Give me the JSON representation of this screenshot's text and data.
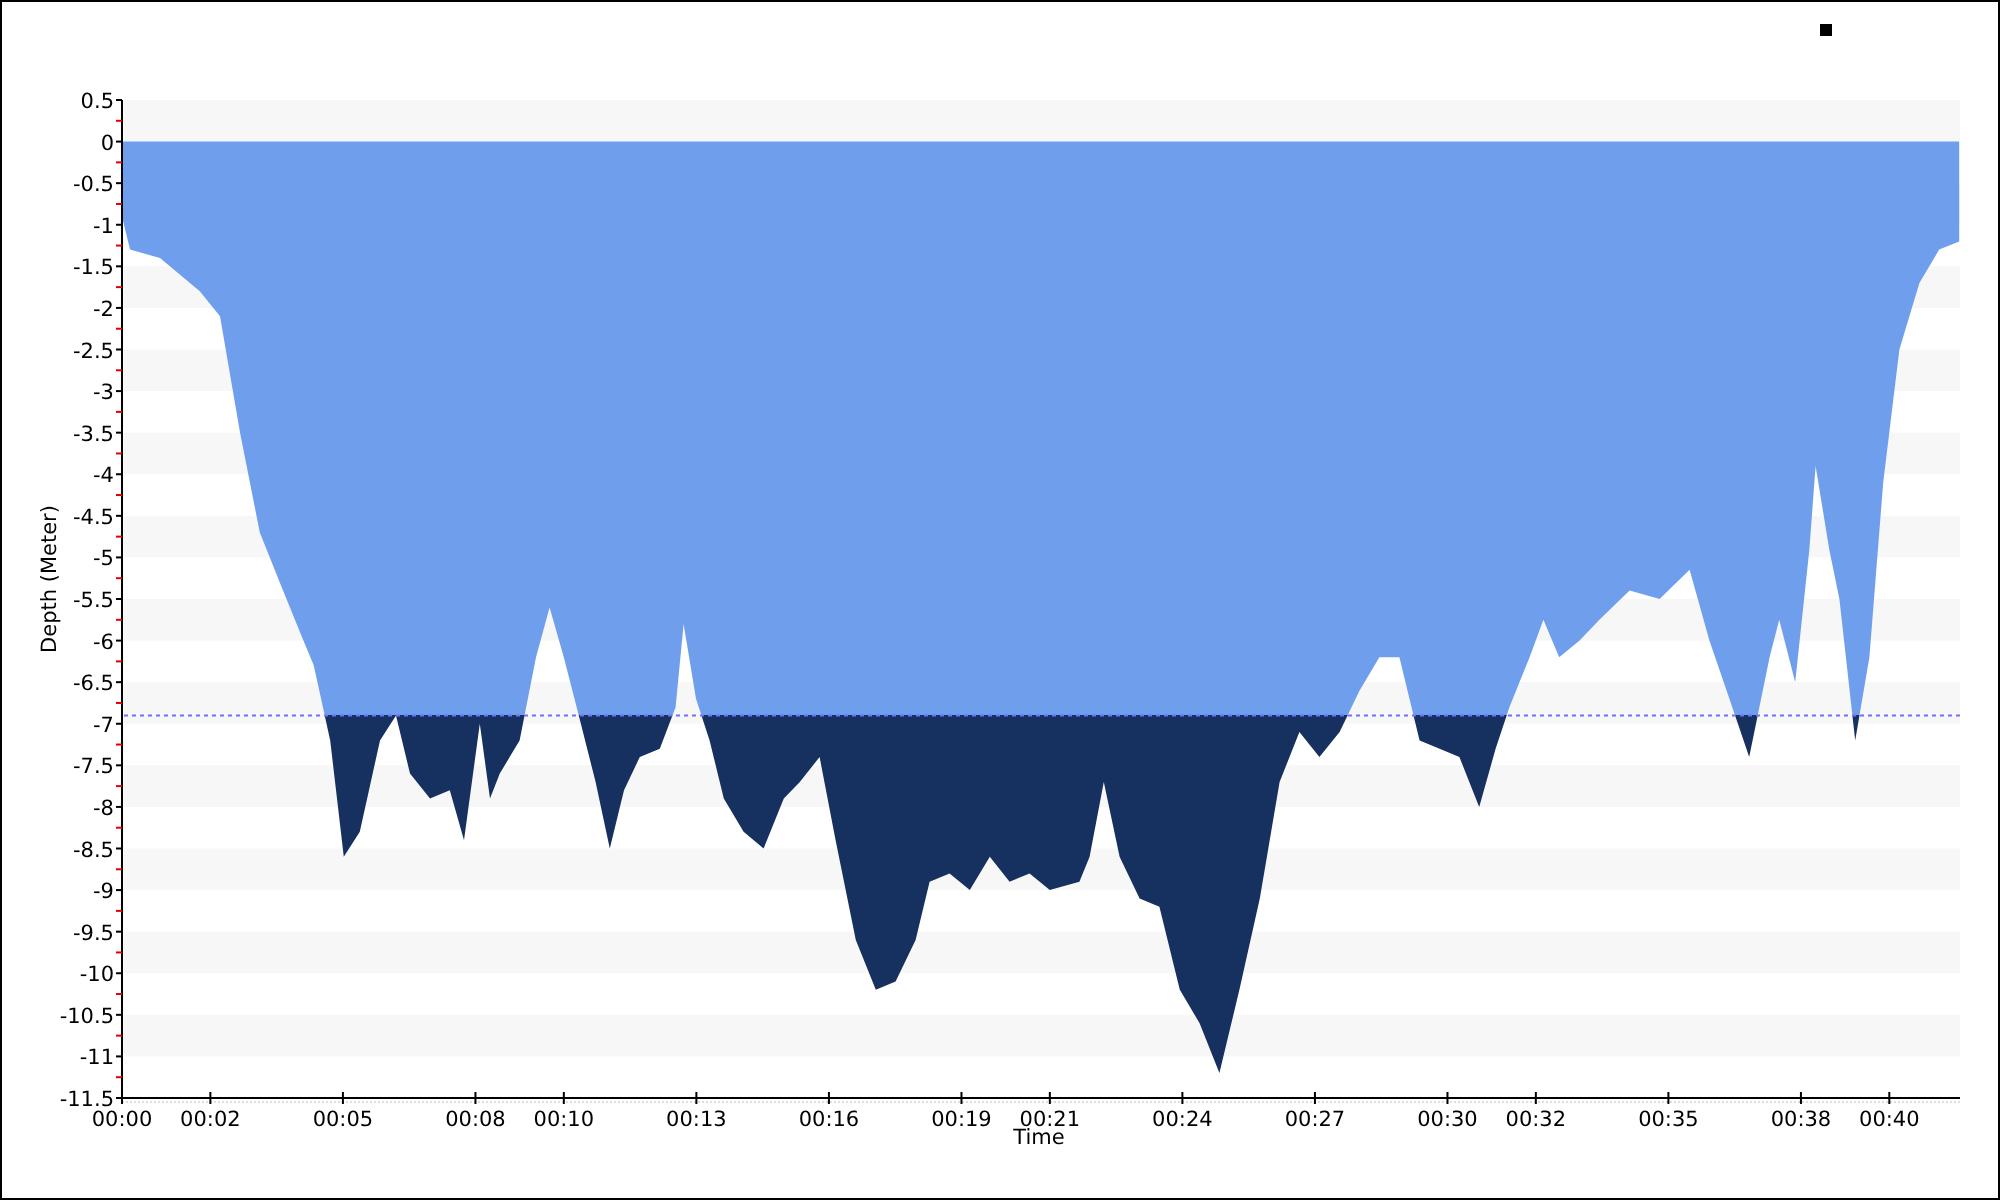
{
  "chart": {
    "legend_marker": true,
    "chart_data": {
      "type": "area",
      "xlabel": "Time",
      "ylabel": "Depth (Meter)",
      "x": [
        0,
        0.18,
        0.86,
        1.76,
        2.22,
        2.67,
        3.12,
        3.57,
        4.03,
        4.34,
        4.71,
        5.02,
        5.38,
        5.84,
        6.2,
        6.52,
        6.97,
        7.42,
        7.74,
        8.1,
        8.33,
        8.55,
        9.0,
        9.37,
        9.68,
        10.0,
        10.36,
        10.72,
        11.04,
        11.36,
        11.72,
        12.17,
        12.53,
        12.71,
        12.99,
        13.3,
        13.62,
        14.07,
        14.52,
        14.98,
        15.34,
        15.79,
        16.15,
        16.61,
        17.06,
        17.51,
        17.96,
        18.28,
        18.73,
        19.19,
        19.64,
        20.09,
        20.54,
        21.0,
        21.67,
        21.9,
        22.22,
        22.58,
        23.03,
        23.48,
        23.94,
        24.39,
        24.84,
        25.29,
        25.75,
        26.2,
        26.65,
        27.1,
        27.56,
        28.01,
        28.46,
        28.91,
        29.37,
        29.82,
        30.27,
        30.72,
        31.09,
        31.4,
        31.86,
        32.17,
        32.53,
        32.99,
        33.44,
        34.12,
        34.8,
        35.48,
        35.93,
        36.38,
        36.83,
        37.29,
        37.51,
        37.87,
        38.19,
        38.33,
        38.64,
        38.87,
        39.23,
        39.55,
        39.86,
        40.23,
        40.68,
        41.13,
        41.58
      ],
      "series": [
        {
          "color": "#6f9fec",
          "values": [
            -0.9,
            -1.3,
            -1.4,
            -1.8,
            -2.1,
            -3.5,
            -4.7,
            -5.3,
            -5.9,
            -6.3,
            -7.2,
            -8.6,
            -8.3,
            -7.2,
            -6.9,
            -7.6,
            -7.9,
            -7.8,
            -8.4,
            -7.0,
            -7.9,
            -7.6,
            -7.2,
            -6.2,
            -5.6,
            -6.2,
            -6.95,
            -7.7,
            -8.5,
            -7.8,
            -7.4,
            -7.3,
            -6.8,
            -5.8,
            -6.7,
            -7.2,
            -7.9,
            -8.3,
            -8.5,
            -7.9,
            -7.7,
            -7.4,
            -8.4,
            -9.6,
            -10.2,
            -10.1,
            -9.6,
            -8.9,
            -8.8,
            -9.0,
            -8.6,
            -8.9,
            -8.8,
            -9.0,
            -8.9,
            -8.6,
            -7.7,
            -8.6,
            -9.1,
            -9.2,
            -10.2,
            -10.6,
            -11.2,
            -10.2,
            -9.1,
            -7.7,
            -7.1,
            -7.4,
            -7.1,
            -6.6,
            -6.2,
            -6.2,
            -7.2,
            -7.3,
            -7.4,
            -8.0,
            -7.3,
            -6.8,
            -6.2,
            -5.75,
            -6.2,
            -6.0,
            -5.75,
            -5.4,
            -5.5,
            -5.15,
            -6.0,
            -6.7,
            -7.4,
            -6.2,
            -5.75,
            -6.5,
            -4.9,
            -3.9,
            -4.9,
            -5.5,
            -7.2,
            -6.2,
            -4.1,
            -2.5,
            -1.7,
            -1.3,
            -1.2
          ]
        }
      ],
      "xlim": [
        0,
        41.6
      ],
      "ylim": [
        -11.5,
        0.5
      ],
      "xticks": [
        {
          "value": 0,
          "label": "00:00"
        },
        {
          "value": 2,
          "label": "00:02"
        },
        {
          "value": 5,
          "label": "00:05"
        },
        {
          "value": 8,
          "label": "00:08"
        },
        {
          "value": 10,
          "label": "00:10"
        },
        {
          "value": 13,
          "label": "00:13"
        },
        {
          "value": 16,
          "label": "00:16"
        },
        {
          "value": 19,
          "label": "00:19"
        },
        {
          "value": 21,
          "label": "00:21"
        },
        {
          "value": 24,
          "label": "00:24"
        },
        {
          "value": 27,
          "label": "00:27"
        },
        {
          "value": 30,
          "label": "00:30"
        },
        {
          "value": 32,
          "label": "00:32"
        },
        {
          "value": 35,
          "label": "00:35"
        },
        {
          "value": 38,
          "label": "00:38"
        },
        {
          "value": 40,
          "label": "00:40"
        }
      ],
      "yticks": [
        0.5,
        0,
        -0.5,
        -1,
        -1.5,
        -2,
        -2.5,
        -3,
        -3.5,
        -4,
        -4.5,
        -5,
        -5.5,
        -6,
        -6.5,
        -7,
        -7.5,
        -8,
        -8.5,
        -9,
        -9.5,
        -10,
        -10.5,
        -11,
        -11.5
      ],
      "ref_lines": [
        {
          "axis": "y",
          "value": -6.9,
          "color": "#7070ff"
        }
      ]
    }
  }
}
